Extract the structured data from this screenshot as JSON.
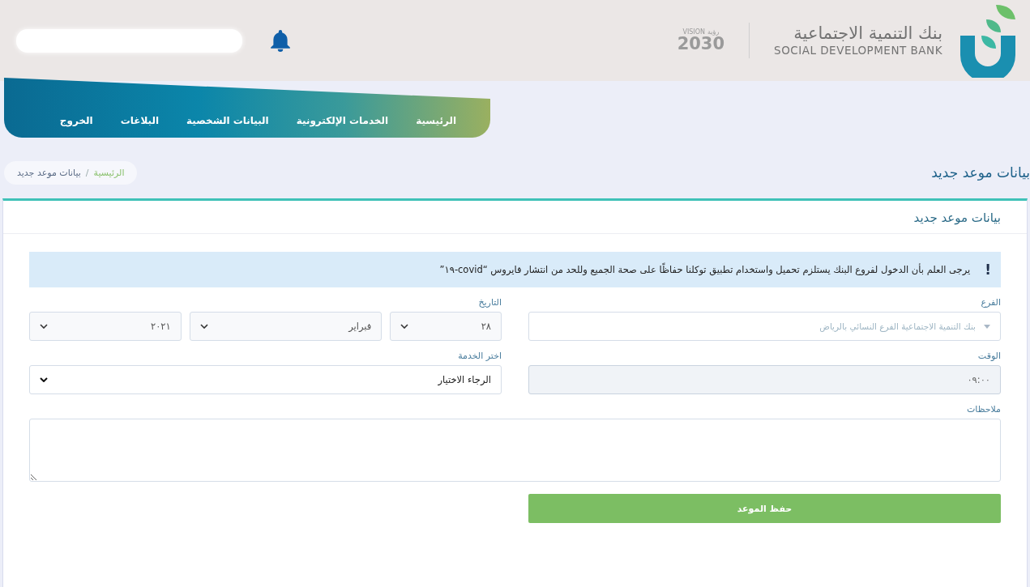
{
  "header": {
    "bank_name_ar": "بنك التنمية الاجتماعية",
    "bank_name_en": "SOCIAL DEVELOPMENT BANK",
    "vision": {
      "word": "VISION",
      "word_ar": "رؤية",
      "year": "2030"
    }
  },
  "nav": {
    "items": [
      {
        "label": "الرئيسية"
      },
      {
        "label": "الخدمات الإلكترونية"
      },
      {
        "label": "البيانات الشخصية"
      },
      {
        "label": "البلاغات"
      },
      {
        "label": "الخروج"
      }
    ]
  },
  "breadcrumb": {
    "items": [
      {
        "label": "الرئيسية",
        "kind": "link"
      },
      {
        "label": "بيانات موعد جديد",
        "kind": "current"
      }
    ],
    "separator": "/"
  },
  "page_title": "بيانات موعد جديد",
  "card": {
    "title": "بيانات موعد جديد",
    "alert": {
      "icon": "!",
      "text": "يرجى العلم بأن الدخول لفروع البنك يستلزم تحميل واستخدام تطبيق توكلنا حفاظًا على صحة الجميع وللحد من انتشار فايروس “covid-١٩”"
    },
    "branch": {
      "label": "الفرع",
      "placeholder": "بنك التنمية الاجتماعية الفرع النسائي بالرياض"
    },
    "date": {
      "label": "التاريخ",
      "parts": [
        {
          "value": "٢٨"
        },
        {
          "value": "فبراير"
        },
        {
          "value": "٢٠٢١"
        }
      ]
    },
    "time": {
      "label": "الوقت",
      "value": "٠٩:٠٠",
      "disabled": true
    },
    "service": {
      "label": "اختر الخدمة",
      "value": "الرجاء الاختيار"
    },
    "notes": {
      "label": "ملاحظات"
    },
    "button": "حفظ الموعد"
  }
}
